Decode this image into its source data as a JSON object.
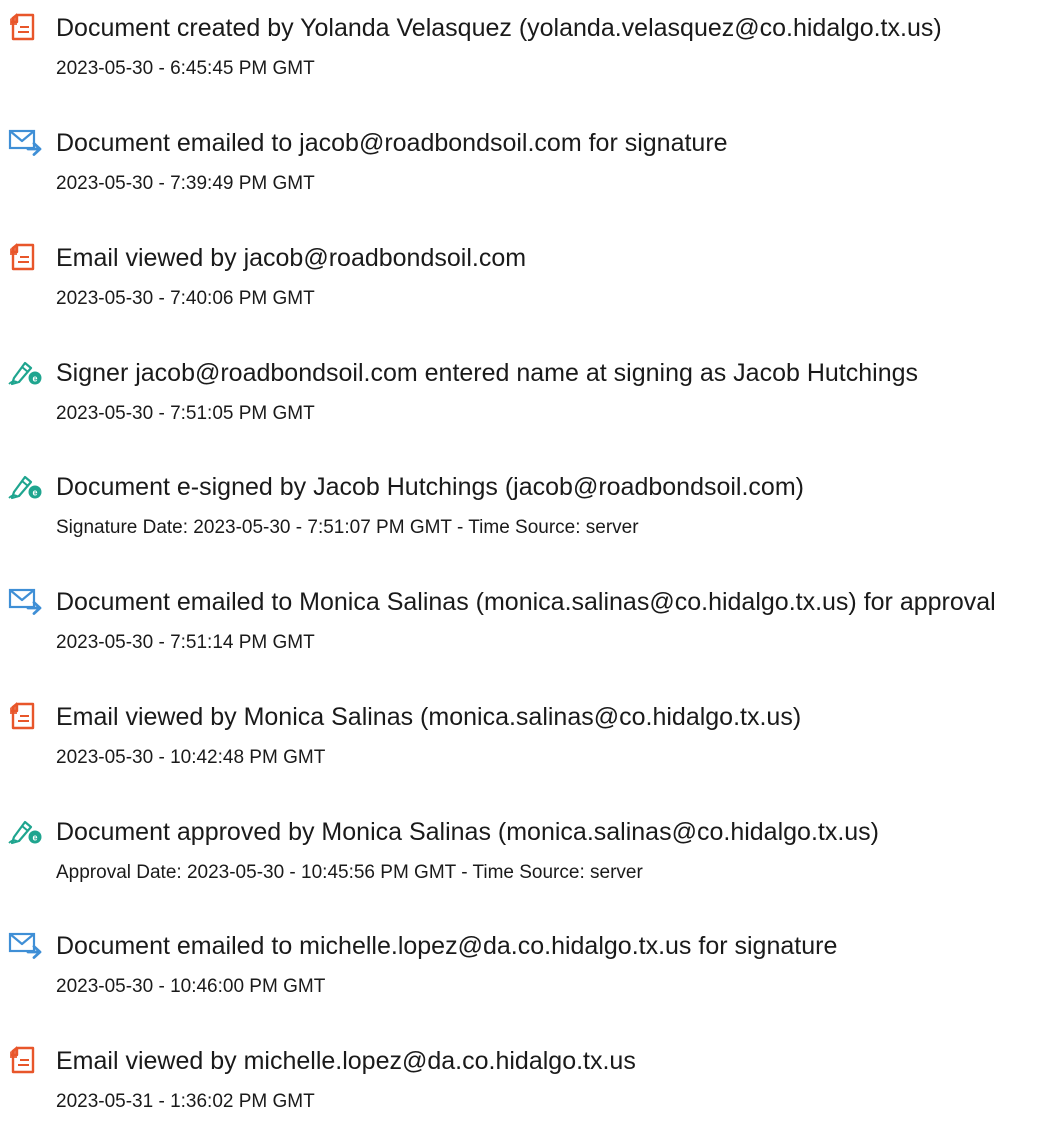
{
  "colors": {
    "document_icon": "#e8562a",
    "email_icon": "#3f8fd6",
    "sign_icon": "#1fa58f",
    "text": "#1a1a1a"
  },
  "events": [
    {
      "icon": "document-icon",
      "title": "Document created by Yolanda Velasquez (yolanda.velasquez@co.hidalgo.tx.us)",
      "detail": "2023-05-30 - 6:45:45 PM GMT"
    },
    {
      "icon": "email-sent-icon",
      "title": "Document emailed to jacob@roadbondsoil.com for signature",
      "detail": "2023-05-30 - 7:39:49 PM GMT"
    },
    {
      "icon": "document-icon",
      "title": "Email viewed by jacob@roadbondsoil.com",
      "detail": "2023-05-30 - 7:40:06 PM GMT"
    },
    {
      "icon": "esign-pen-icon",
      "title": "Signer jacob@roadbondsoil.com entered name at signing as Jacob Hutchings",
      "detail": "2023-05-30 - 7:51:05 PM GMT"
    },
    {
      "icon": "esign-pen-icon",
      "title": "Document e-signed by Jacob Hutchings (jacob@roadbondsoil.com)",
      "detail": "Signature Date: 2023-05-30 - 7:51:07 PM GMT - Time Source: server"
    },
    {
      "icon": "email-sent-icon",
      "title": "Document emailed to Monica Salinas (monica.salinas@co.hidalgo.tx.us) for approval",
      "detail": "2023-05-30 - 7:51:14 PM GMT"
    },
    {
      "icon": "document-icon",
      "title": "Email viewed by Monica Salinas (monica.salinas@co.hidalgo.tx.us)",
      "detail": "2023-05-30 - 10:42:48 PM GMT"
    },
    {
      "icon": "esign-pen-icon",
      "title": "Document approved by Monica Salinas (monica.salinas@co.hidalgo.tx.us)",
      "detail": "Approval Date: 2023-05-30 - 10:45:56 PM GMT - Time Source: server"
    },
    {
      "icon": "email-sent-icon",
      "title": "Document emailed to michelle.lopez@da.co.hidalgo.tx.us for signature",
      "detail": "2023-05-30 - 10:46:00 PM GMT"
    },
    {
      "icon": "document-icon",
      "title": "Email viewed by michelle.lopez@da.co.hidalgo.tx.us",
      "detail": "2023-05-31 - 1:36:02 PM GMT"
    }
  ]
}
